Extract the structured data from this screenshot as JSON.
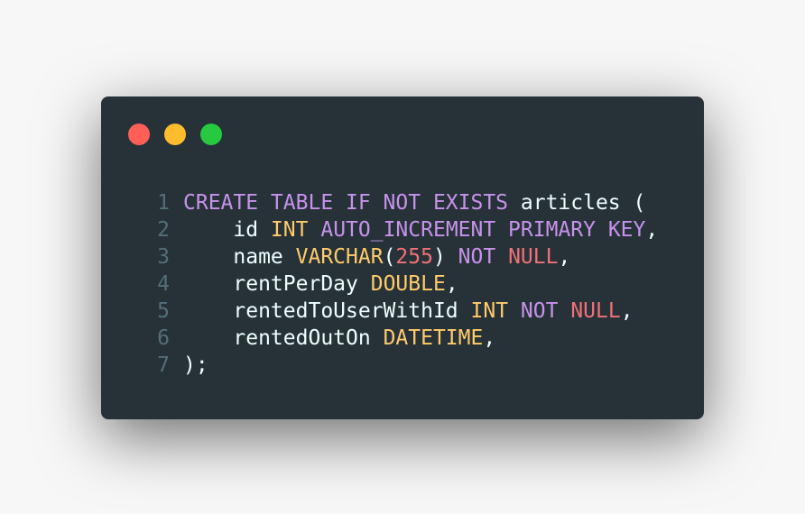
{
  "colors": {
    "background": "#f7f7f7",
    "window": "#263238",
    "close": "#ff5f56",
    "minimize": "#ffbd2e",
    "maximize": "#27c93f",
    "line_number": "#546e7a",
    "plain": "#eeffff",
    "keyword": "#c792ea",
    "type": "#ffcb6b",
    "value": "#f07178"
  },
  "window_controls": {
    "close": "red-dot",
    "minimize": "yellow-dot",
    "maximize": "green-dot"
  },
  "code": {
    "language": "sql",
    "lines": [
      {
        "number": "1",
        "tokens": [
          {
            "text": "CREATE TABLE IF NOT EXISTS",
            "kind": "keyword"
          },
          {
            "text": " articles (",
            "kind": "plain"
          }
        ]
      },
      {
        "number": "2",
        "tokens": [
          {
            "text": "    id ",
            "kind": "plain"
          },
          {
            "text": "INT",
            "kind": "type"
          },
          {
            "text": " ",
            "kind": "plain"
          },
          {
            "text": "AUTO_INCREMENT PRIMARY KEY",
            "kind": "keyword"
          },
          {
            "text": ",",
            "kind": "plain"
          }
        ]
      },
      {
        "number": "3",
        "tokens": [
          {
            "text": "    name ",
            "kind": "plain"
          },
          {
            "text": "VARCHAR",
            "kind": "type"
          },
          {
            "text": "(",
            "kind": "plain"
          },
          {
            "text": "255",
            "kind": "value"
          },
          {
            "text": ") ",
            "kind": "plain"
          },
          {
            "text": "NOT",
            "kind": "keyword"
          },
          {
            "text": " ",
            "kind": "plain"
          },
          {
            "text": "NULL",
            "kind": "value"
          },
          {
            "text": ",",
            "kind": "plain"
          }
        ]
      },
      {
        "number": "4",
        "tokens": [
          {
            "text": "    rentPerDay ",
            "kind": "plain"
          },
          {
            "text": "DOUBLE",
            "kind": "type"
          },
          {
            "text": ",",
            "kind": "plain"
          }
        ]
      },
      {
        "number": "5",
        "tokens": [
          {
            "text": "    rentedToUserWithId ",
            "kind": "plain"
          },
          {
            "text": "INT",
            "kind": "type"
          },
          {
            "text": " ",
            "kind": "plain"
          },
          {
            "text": "NOT",
            "kind": "keyword"
          },
          {
            "text": " ",
            "kind": "plain"
          },
          {
            "text": "NULL",
            "kind": "value"
          },
          {
            "text": ",",
            "kind": "plain"
          }
        ]
      },
      {
        "number": "6",
        "tokens": [
          {
            "text": "    rentedOutOn ",
            "kind": "plain"
          },
          {
            "text": "DATETIME",
            "kind": "type"
          },
          {
            "text": ",",
            "kind": "plain"
          }
        ]
      },
      {
        "number": "7",
        "tokens": [
          {
            "text": ");",
            "kind": "plain"
          }
        ]
      }
    ]
  }
}
